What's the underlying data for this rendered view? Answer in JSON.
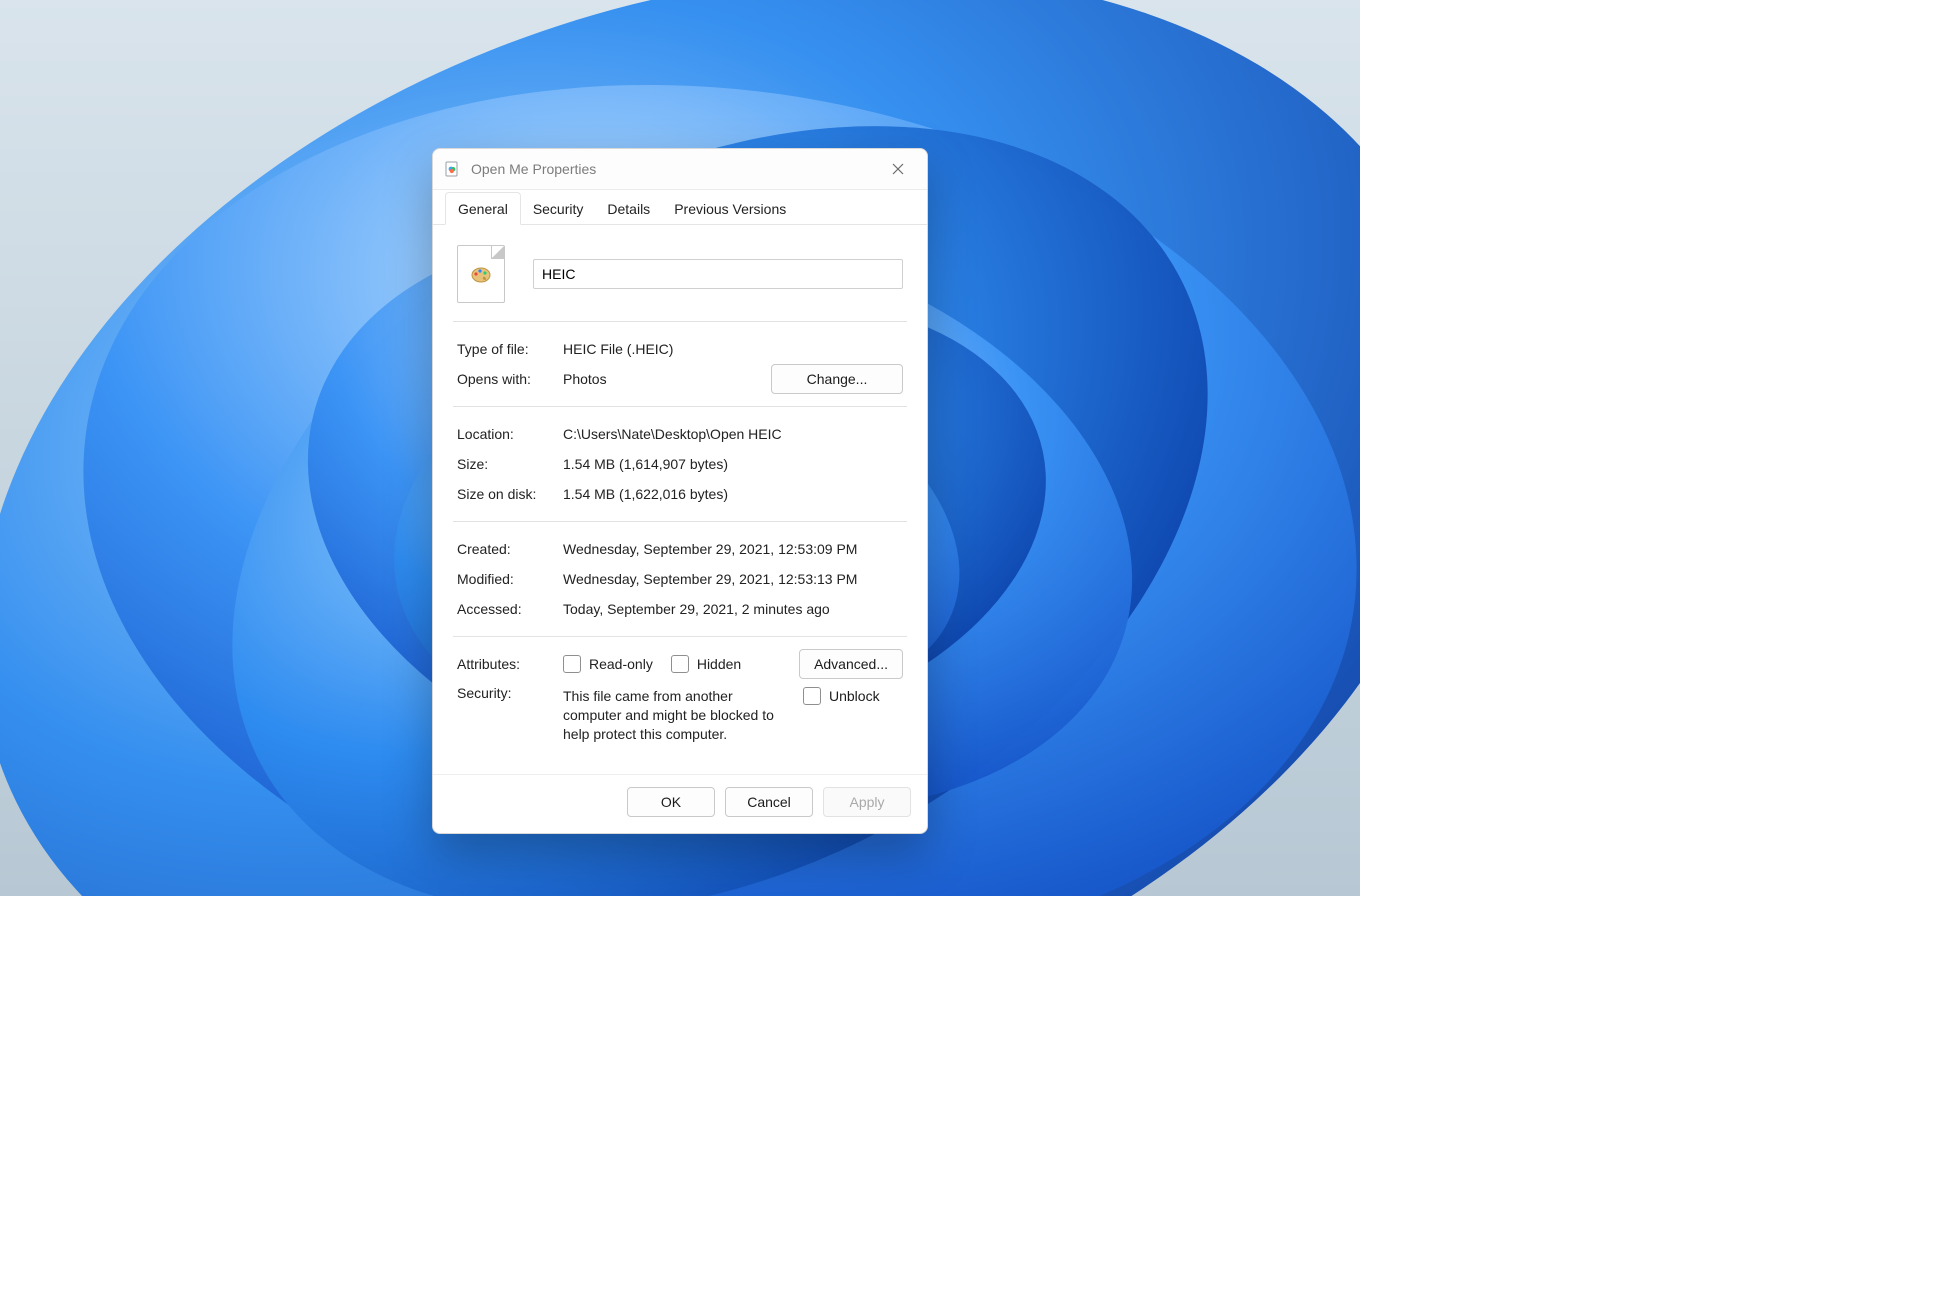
{
  "window": {
    "title": "Open Me Properties"
  },
  "tabs": {
    "general": "General",
    "security": "Security",
    "details": "Details",
    "previous_versions": "Previous Versions"
  },
  "file": {
    "name_value": "HEIC"
  },
  "labels": {
    "type_of_file": "Type of file:",
    "opens_with": "Opens with:",
    "location": "Location:",
    "size": "Size:",
    "size_on_disk": "Size on disk:",
    "created": "Created:",
    "modified": "Modified:",
    "accessed": "Accessed:",
    "attributes": "Attributes:",
    "security": "Security:"
  },
  "values": {
    "type_of_file": "HEIC File (.HEIC)",
    "opens_with": "Photos",
    "location": "C:\\Users\\Nate\\Desktop\\Open HEIC",
    "size": "1.54 MB (1,614,907 bytes)",
    "size_on_disk": "1.54 MB (1,622,016 bytes)",
    "created": "Wednesday, September 29, 2021, 12:53:09 PM",
    "modified": "Wednesday, September 29, 2021, 12:53:13 PM",
    "accessed": "Today, September 29, 2021, 2 minutes ago"
  },
  "buttons": {
    "change": "Change...",
    "advanced": "Advanced...",
    "ok": "OK",
    "cancel": "Cancel",
    "apply": "Apply"
  },
  "attributes": {
    "read_only": "Read-only",
    "hidden": "Hidden",
    "unblock": "Unblock"
  },
  "security_text": "This file came from another computer and might be blocked to help protect this computer."
}
